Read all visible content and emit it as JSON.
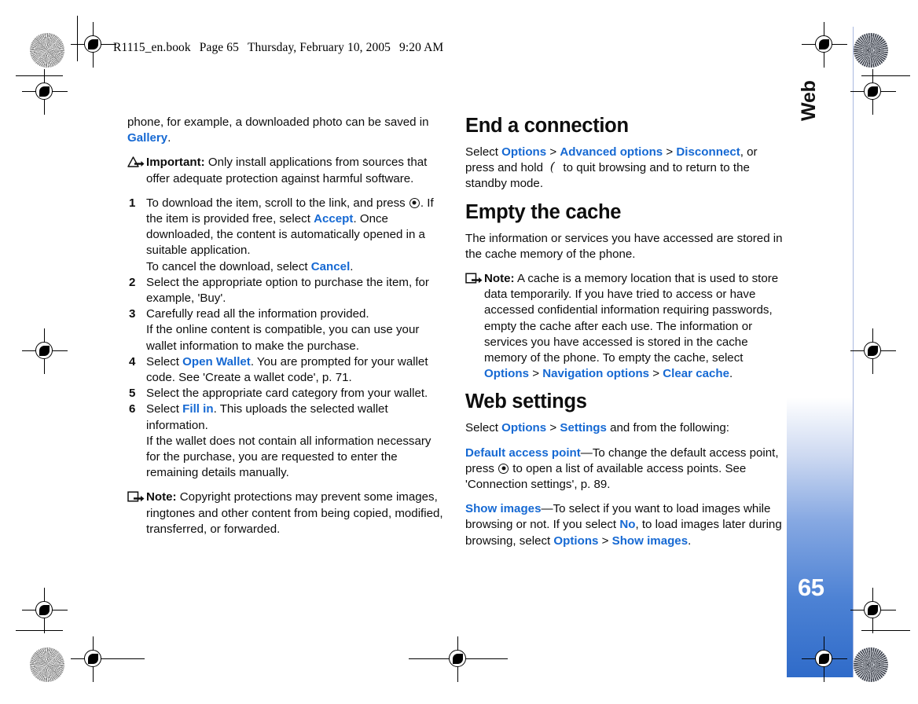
{
  "document": {
    "running_header": {
      "filename": "R1115_en.book",
      "page_label": "Page 65",
      "date": "Thursday, February 10, 2005",
      "time": "9:20 AM"
    },
    "side_tab": {
      "chapter": "Web",
      "page_number": "65"
    },
    "colors": {
      "link_blue": "#1669d3",
      "tab_blue": "#2f6bc9",
      "page_border": "#aab8e0",
      "text": "#0d0d0d"
    }
  },
  "left_column": {
    "intro": {
      "text_before_link": "phone, for example, a downloaded photo can be saved in ",
      "link": "Gallery",
      "text_after_link": "."
    },
    "important_note": {
      "icon": "warning-triangle-arrow-icon",
      "label": "Important:",
      "body": "Only install applications from sources that offer adequate protection against harmful software."
    },
    "steps": [
      {
        "number": "1",
        "part1": "To download the item, scroll to the link, and press ",
        "icon": "scroll-key-icon",
        "part2": ". If the item is provided free, select ",
        "link1": "Accept",
        "part3": ". Once downloaded, the content is automatically opened in a suitable application.",
        "sub_part1": "To cancel the download, select ",
        "sub_link": "Cancel",
        "sub_part2": "."
      },
      {
        "number": "2",
        "part1": "Select the appropriate option to purchase the item, for example, 'Buy'."
      },
      {
        "number": "3",
        "part1": "Carefully read all the information provided.",
        "sub_part1": "If the online content is compatible, you can use your wallet information to make the purchase."
      },
      {
        "number": "4",
        "part1": "Select ",
        "link1": "Open Wallet",
        "part3": ". You are prompted for your wallet code. See 'Create a wallet code', p. 71."
      },
      {
        "number": "5",
        "part1": "Select the appropriate card category from your wallet."
      },
      {
        "number": "6",
        "part1": "Select ",
        "link1": "Fill in",
        "part3": ". This uploads the selected wallet information.",
        "sub_part1": "If the wallet does not contain all information necessary for the purchase, you are requested to enter the remaining details manually."
      }
    ],
    "copyright_note": {
      "icon": "note-arrow-icon",
      "label": "Note:",
      "body": "Copyright protections may prevent some images, ringtones and other content from being copied, modified, transferred, or forwarded."
    }
  },
  "right_column": {
    "end_connection": {
      "heading": "End a connection",
      "p1_before": "Select ",
      "p1_link1": "Options",
      "p1_sep1": " > ",
      "p1_link2": "Advanced options",
      "p1_sep2": " > ",
      "p1_link3": "Disconnect",
      "p1_mid": ", or press and hold ",
      "p1_icon": "end-key-icon",
      "p1_after": " to quit browsing and to return to the standby mode."
    },
    "empty_cache": {
      "heading": "Empty the cache",
      "p1": "The information or services you have accessed are stored in the cache memory of the phone.",
      "note": {
        "icon": "note-arrow-icon",
        "label": "Note:",
        "body_before": "A cache is a memory location that is used to store data temporarily. If you have tried to access or have accessed confidential information requiring passwords, empty the cache after each use. The information or services you have accessed is stored in the cache memory of the phone. To empty the cache, select ",
        "link1": "Options",
        "sep1": " > ",
        "link2": "Navigation options",
        "sep2": " > ",
        "link3": "Clear cache",
        "body_after": "."
      }
    },
    "web_settings": {
      "heading": "Web settings",
      "p1_before": "Select ",
      "p1_link1": "Options",
      "p1_sep1": " > ",
      "p1_link2": "Settings",
      "p1_after": " and from the following:",
      "default_access_point": {
        "link": "Default access point",
        "before_icon": "—To change the default access point, press ",
        "icon": "scroll-key-icon",
        "after_icon": " to open a list of available access points. See 'Connection settings', p. 89."
      },
      "show_images": {
        "link": "Show images",
        "part1": "—To select if you want to load images while browsing or not. If you select ",
        "link2": "No",
        "part2": ", to load images later during browsing, select ",
        "link3": "Options",
        "sep": " > ",
        "link4": "Show images",
        "part3": "."
      }
    }
  }
}
